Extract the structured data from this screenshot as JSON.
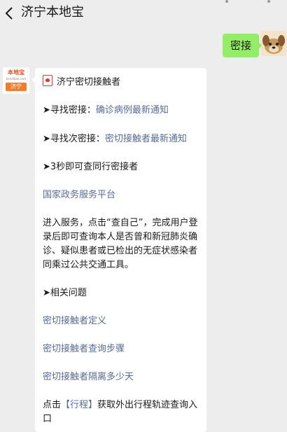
{
  "header": {
    "back_icon": "chevron-left-icon",
    "title": "济宁本地宝"
  },
  "outgoing": {
    "text": "密接",
    "avatar_icon": "dog-avatar"
  },
  "incoming": {
    "avatar": {
      "brand_top": "本地宝",
      "brand_mid": "bendibao.com",
      "brand_city": "济宁"
    },
    "heading": "济宁密切接触者",
    "lines": [
      {
        "prefix": "➤寻找密接：",
        "link": "确诊病例最新通知"
      },
      {
        "prefix": "➤寻找次密接：",
        "link": "密切接触者最新通知"
      },
      {
        "prefix": "➤3秒即可查同行密接者",
        "link": ""
      }
    ],
    "platform_link": "国家政务服务平台",
    "paragraph": "进入服务，点击“查自己”，完成用户登录后即可查询本人是否曾和新冠肺炎确诊、疑似患者或已检出的无症状感染者同乘过公共交通工具。",
    "related_title": "➤相关问题",
    "related_links": [
      "密切接触者定义",
      "密切接触者查询步骤",
      "密切接触者隔离多少天"
    ],
    "footer_prefix": "点击",
    "footer_link": "【行程】",
    "footer_suffix": "获取外出行程轨迹查询入口"
  },
  "colors": {
    "background": "#ededed",
    "outgoing_bubble": "#95ec69",
    "link": "#576b95",
    "brand_orange": "#ef7d2b"
  }
}
